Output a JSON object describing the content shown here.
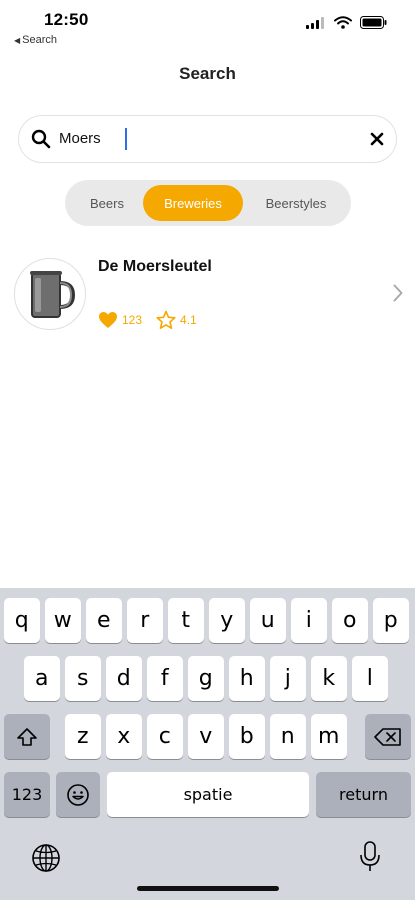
{
  "status": {
    "time": "12:50",
    "back_label": "Search"
  },
  "nav": {
    "title": "Search"
  },
  "search": {
    "value": "Moers",
    "placeholder": ""
  },
  "segments": [
    {
      "label": "Beers",
      "selected": false
    },
    {
      "label": "Breweries",
      "selected": true
    },
    {
      "label": "Beerstyles",
      "selected": false
    }
  ],
  "colors": {
    "accent": "#f5a800",
    "keyboard_bg": "#d3d6dc"
  },
  "results": [
    {
      "name": "De Moersleutel",
      "likes": "123",
      "rating": "4.1",
      "icon": "beer-mug-icon"
    }
  ],
  "keyboard": {
    "row1": [
      "q",
      "w",
      "e",
      "r",
      "t",
      "y",
      "u",
      "i",
      "o",
      "p"
    ],
    "row2": [
      "a",
      "s",
      "d",
      "f",
      "g",
      "h",
      "j",
      "k",
      "l"
    ],
    "row3": [
      "z",
      "x",
      "c",
      "v",
      "b",
      "n",
      "m"
    ],
    "numbers_label": "123",
    "space_label": "spatie",
    "return_label": "return"
  }
}
